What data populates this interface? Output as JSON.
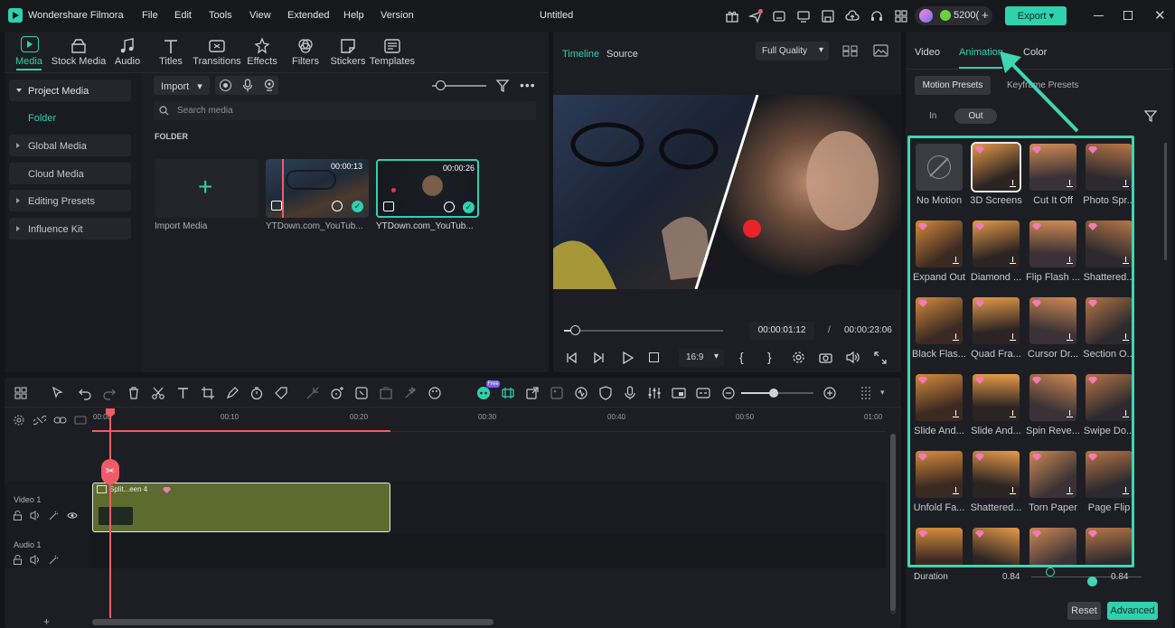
{
  "app": {
    "name": "Wondershare Filmora",
    "project_title": "Untitled",
    "credits": "5200(",
    "export_label": "Export"
  },
  "menu": [
    "File",
    "Edit",
    "Tools",
    "View",
    "Extended",
    "Help",
    "Version"
  ],
  "media_tabs": [
    {
      "label": "Media",
      "icon": "media-icon"
    },
    {
      "label": "Stock Media",
      "icon": "stock-media-icon"
    },
    {
      "label": "Audio",
      "icon": "audio-icon"
    },
    {
      "label": "Titles",
      "icon": "titles-icon"
    },
    {
      "label": "Transitions",
      "icon": "transitions-icon"
    },
    {
      "label": "Effects",
      "icon": "effects-icon"
    },
    {
      "label": "Filters",
      "icon": "filters-icon"
    },
    {
      "label": "Stickers",
      "icon": "stickers-icon"
    },
    {
      "label": "Templates",
      "icon": "templates-icon"
    }
  ],
  "sidebar": {
    "project_media": "Project Media",
    "folder": "Folder",
    "global_media": "Global Media",
    "cloud_media": "Cloud Media",
    "editing_presets": "Editing Presets",
    "influence_kit": "Influence Kit"
  },
  "media_toolbar": {
    "import_label": "Import",
    "search_placeholder": "Search media",
    "folder_heading": "FOLDER"
  },
  "media_items": [
    {
      "label": "Import Media"
    },
    {
      "label": "YTDown.com_YouTub...",
      "duration": "00:00:13"
    },
    {
      "label": "YTDown.com_YouTub...",
      "duration": "00:00:26"
    }
  ],
  "player": {
    "tab_timeline": "Timeline",
    "tab_source": "Source",
    "quality": "Full Quality",
    "current_time": "00:00:01:12",
    "separator": "/",
    "total_time": "00:00:23:06",
    "aspect": "16:9",
    "progress": 0.07
  },
  "right_panel": {
    "tabs": [
      "Video",
      "Animation",
      "Color"
    ],
    "subtabs": [
      "Motion Presets",
      "Keyframe Presets"
    ],
    "inout": [
      "In",
      "Out"
    ],
    "duration_label": "Duration",
    "duration_value_left": "0.84",
    "duration_value_right": "0.84",
    "reset_label": "Reset",
    "advanced_label": "Advanced"
  },
  "presets": [
    "No Motion",
    "3D Screens",
    "Cut It Off",
    "Photo Spr...",
    "Expand Out",
    "Diamond ...",
    "Flip Flash ...",
    "Shattered...",
    "Black Flas...",
    "Quad Fra...",
    "Cursor Dr...",
    "Section O...",
    "Slide And...",
    "Slide And...",
    "Spin Reve...",
    "Swipe Do...",
    "Unfold Fa...",
    "Shattered...",
    "Torn Paper",
    "Page Flip",
    "",
    "",
    "",
    ""
  ],
  "timeline": {
    "ruler": [
      "00:00",
      "00:10",
      "00:20",
      "00:30",
      "00:40",
      "00:50",
      "01:00"
    ],
    "video_track": "Video 1",
    "audio_track": "Audio 1",
    "clip_label": "Split...een 4",
    "free_badge": "Free"
  },
  "colors": {
    "accent": "#2fd1ae",
    "playhead": "#f05b6a",
    "clip": "#5e6b2f",
    "highlight_box": "#3fd6b2"
  }
}
